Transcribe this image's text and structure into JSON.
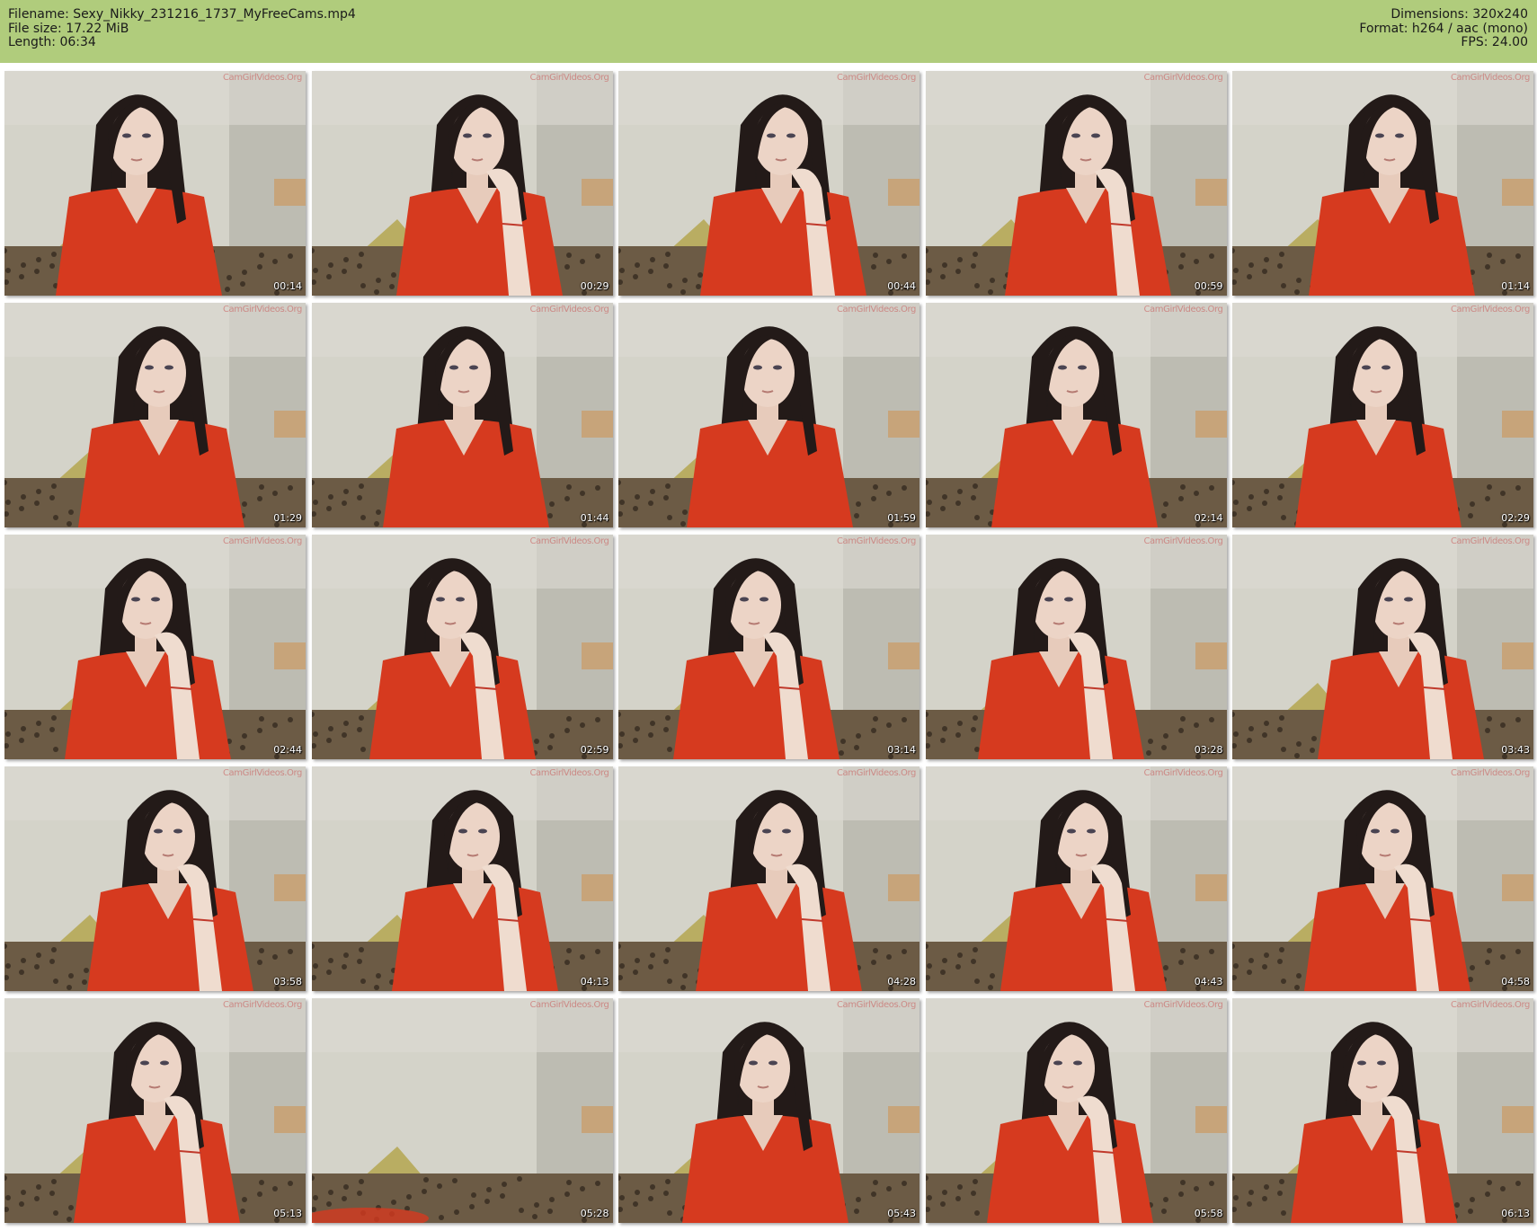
{
  "header": {
    "filename": "Filename: Sexy_Nikky_231216_1737_MyFreeCams.mp4",
    "filesize": "File size: 17.22 MiB",
    "length": "Length: 06:34",
    "dimensions": "Dimensions: 320x240",
    "format": "Format: h264 / aac (mono)",
    "fps": "FPS: 24.00"
  },
  "watermark": "CamGirlVideos.Org",
  "colors": {
    "header_bg": "#b0cc7c",
    "shirt": "#d63a1f",
    "hair": "#231a18",
    "wall": "#d4d3c9"
  },
  "thumbnails": [
    {
      "time": "00:14",
      "person": true,
      "hand": false
    },
    {
      "time": "00:29",
      "person": true,
      "hand": true
    },
    {
      "time": "00:44",
      "person": true,
      "hand": true
    },
    {
      "time": "00:59",
      "person": true,
      "hand": true
    },
    {
      "time": "01:14",
      "person": true,
      "hand": false
    },
    {
      "time": "01:29",
      "person": true,
      "hand": false
    },
    {
      "time": "01:44",
      "person": true,
      "hand": false
    },
    {
      "time": "01:59",
      "person": true,
      "hand": false
    },
    {
      "time": "02:14",
      "person": true,
      "hand": false
    },
    {
      "time": "02:29",
      "person": true,
      "hand": false
    },
    {
      "time": "02:44",
      "person": true,
      "hand": true
    },
    {
      "time": "02:59",
      "person": true,
      "hand": true
    },
    {
      "time": "03:14",
      "person": true,
      "hand": true
    },
    {
      "time": "03:28",
      "person": true,
      "hand": true
    },
    {
      "time": "03:43",
      "person": true,
      "hand": true
    },
    {
      "time": "03:58",
      "person": true,
      "hand": true
    },
    {
      "time": "04:13",
      "person": true,
      "hand": true
    },
    {
      "time": "04:28",
      "person": true,
      "hand": true
    },
    {
      "time": "04:43",
      "person": true,
      "hand": true
    },
    {
      "time": "04:58",
      "person": true,
      "hand": true
    },
    {
      "time": "05:13",
      "person": true,
      "hand": true
    },
    {
      "time": "05:28",
      "person": false,
      "hand": false
    },
    {
      "time": "05:43",
      "person": true,
      "hand": false
    },
    {
      "time": "05:58",
      "person": true,
      "hand": true
    },
    {
      "time": "06:13",
      "person": true,
      "hand": true
    }
  ]
}
